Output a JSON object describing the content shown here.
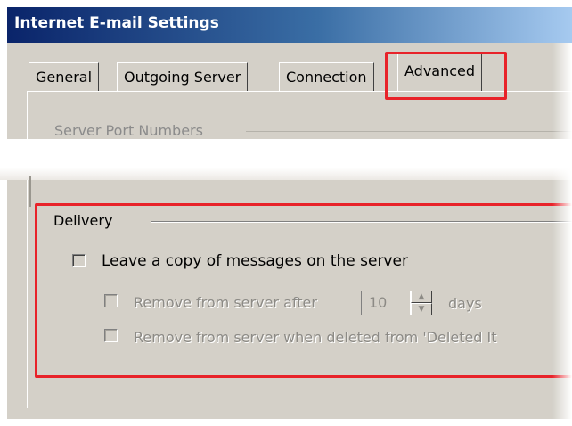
{
  "window": {
    "title": "Internet E-mail Settings"
  },
  "tabs": [
    {
      "label": "General"
    },
    {
      "label": "Outgoing Server"
    },
    {
      "label": "Connection"
    },
    {
      "label": "Advanced"
    }
  ],
  "server_port_numbers": {
    "label": "Server Port Numbers"
  },
  "delivery": {
    "label": "Delivery",
    "leave_copy": {
      "label": "Leave a copy of messages on the server",
      "checked": false
    },
    "remove_after": {
      "label": "Remove from server after",
      "value": "10",
      "unit": "days",
      "checked": false,
      "enabled": false
    },
    "remove_deleted": {
      "label": "Remove from server when deleted from 'Deleted It",
      "checked": false,
      "enabled": false
    }
  },
  "colors": {
    "highlight": "#e8232a",
    "dialog_bg": "#d4d0c8",
    "title_start": "#0a246a"
  }
}
